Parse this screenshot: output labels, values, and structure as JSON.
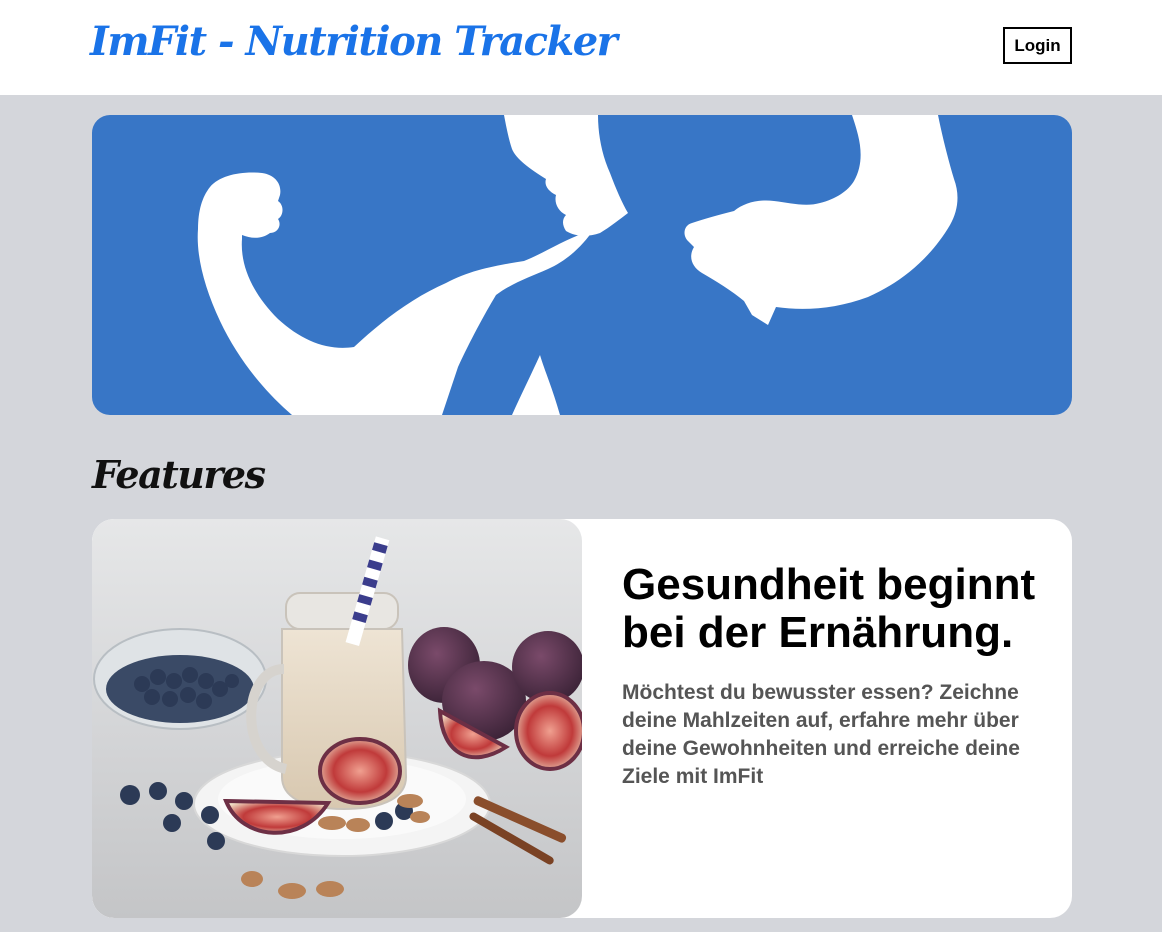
{
  "header": {
    "brand": "ImFit - Nutrition Tracker",
    "login_label": "Login"
  },
  "hero": {
    "icon": "flexing-arms-icon"
  },
  "features": {
    "section_title": "Features",
    "items": [
      {
        "heading": "Gesundheit beginnt bei der Ernährung.",
        "description": "Möchtest du bewusster essen? Zeichne deine Mahlzeiten auf, erfahre mehr über deine Gewohnheiten und erreiche deine Ziele mit ImFit",
        "image": "smoothie-with-figs-and-blueberries-photo"
      }
    ]
  },
  "colors": {
    "brand": "#1a73e8",
    "hero_bg": "#3876c6",
    "page_bg": "#d4d6db",
    "card_bg": "#ffffff",
    "desc_text": "#555555"
  }
}
